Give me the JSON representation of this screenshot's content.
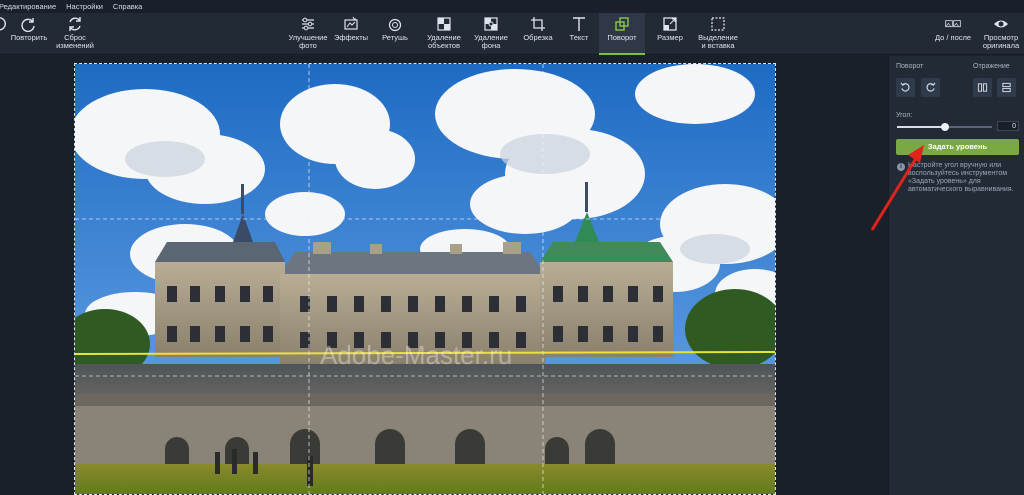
{
  "menu": {
    "items": [
      "Редактирование",
      "Настройки",
      "Справка"
    ]
  },
  "toolbar": {
    "left": [
      {
        "label": "Повторить",
        "icon": "redo-icon"
      },
      {
        "label": "Сброс\nизменений",
        "icon": "reset-icon"
      }
    ],
    "tools": [
      {
        "label": "Улучшение\nфото",
        "icon": "enhance-sliders-icon"
      },
      {
        "label": "Эффекты",
        "icon": "effects-icon"
      },
      {
        "label": "Ретушь",
        "icon": "retouch-icon"
      },
      {
        "label": "Удаление\nобъектов",
        "icon": "object-removal-icon"
      },
      {
        "label": "Удаление\nфона",
        "icon": "background-removal-icon"
      },
      {
        "label": "Обрезка",
        "icon": "crop-icon"
      },
      {
        "label": "Текст",
        "icon": "text-icon"
      },
      {
        "label": "Поворот",
        "icon": "rotate-icon",
        "active": true
      },
      {
        "label": "Размер",
        "icon": "resize-icon"
      },
      {
        "label": "Выделение\nи вставка",
        "icon": "selection-icon"
      }
    ],
    "right": [
      {
        "label": "До / после",
        "icon": "before-after-icon"
      },
      {
        "label": "Просмотр\nоригинала",
        "icon": "eye-icon"
      }
    ]
  },
  "watermark": "Adobe-Master.ru",
  "panel": {
    "rotate_label": "Поворот",
    "flip_label": "Отражение",
    "angle_label": "Угол:",
    "angle_value": "0",
    "slider_level": 0.5,
    "apply_button": "Задать уровень",
    "info_text": "Настройте угол вручную или воспользуйтесь инструментом «Задать уровень» для автоматического выравнивания."
  },
  "colors": {
    "accent_green": "#7aa842",
    "level_line": "#e8e23a",
    "arrow_red": "#e0231b"
  }
}
